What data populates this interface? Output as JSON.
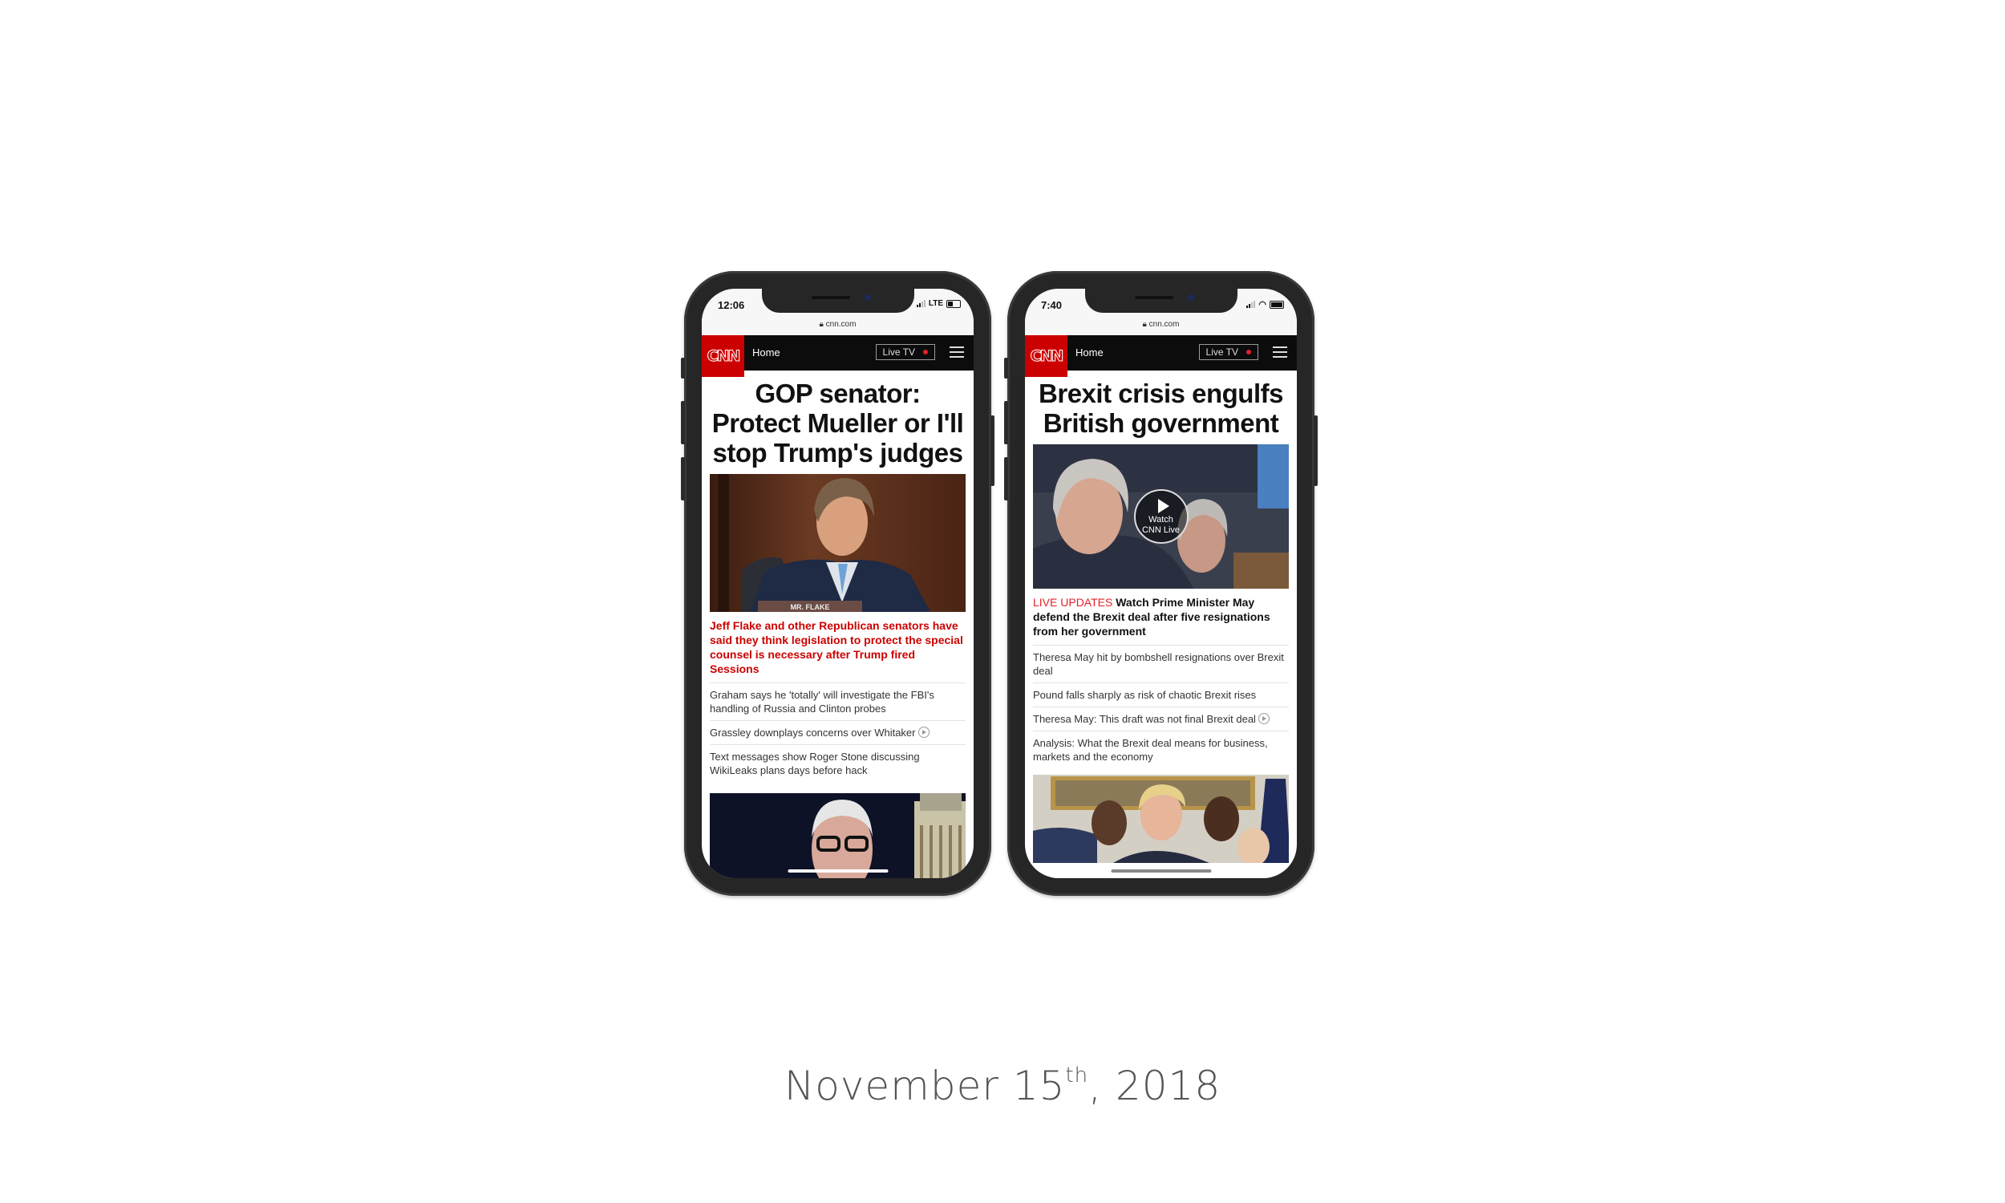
{
  "caption": {
    "month_day": "November 15",
    "suffix": "th",
    "year": ", 2018"
  },
  "phones": [
    {
      "status": {
        "time": "12:06",
        "network": "LTE",
        "battery_level": 0.4
      },
      "url": "cnn.com",
      "nav": {
        "logo": "CNN",
        "home": "Home",
        "live_tv": "Live TV"
      },
      "headline": "GOP senator: Protect Mueller or I'll stop Trump's judges",
      "hero_alt": "Jeff Flake at hearing, nameplate MR. FLAKE",
      "nameplate": "MR. FLAKE",
      "main_story": "Jeff Flake and other Republican senators have said they think legislation to protect the special counsel is necessary after Trump fired Sessions",
      "stories": [
        {
          "text": "Graham says he 'totally' will investigate the FBI's handling of Russia and Clinton probes",
          "video": false
        },
        {
          "text": "Grassley downplays concerns over Whitaker",
          "video": true
        },
        {
          "text": "Text messages show Roger Stone discussing WikiLeaks plans days before hack",
          "video": false
        }
      ]
    },
    {
      "status": {
        "time": "7:40",
        "network": "wifi",
        "battery_level": 0.9
      },
      "url": "cnn.com",
      "nav": {
        "logo": "CNN",
        "home": "Home",
        "live_tv": "Live TV"
      },
      "headline": "Brexit crisis engulfs British government",
      "hero_alt": "Theresa May in Parliament",
      "watch_label_1": "Watch",
      "watch_label_2": "CNN Live",
      "main_story_tag": "LIVE UPDATES",
      "main_story": "Watch Prime Minister May defend the Brexit deal after five resignations from her government",
      "stories": [
        {
          "text": "Theresa May hit by bombshell resignations over Brexit deal",
          "video": false
        },
        {
          "text": "Pound falls sharply as risk of chaotic Brexit rises",
          "video": false
        },
        {
          "text": "Theresa May: This draft was not final Brexit deal",
          "video": true
        },
        {
          "text": "Analysis: What the Brexit deal means for business, markets and the economy",
          "video": false
        }
      ]
    }
  ],
  "colors": {
    "cnn_red": "#cc0000",
    "live_red": "#e4202a",
    "nav_black": "#0c0c0c",
    "caption_gray": "#555555"
  }
}
